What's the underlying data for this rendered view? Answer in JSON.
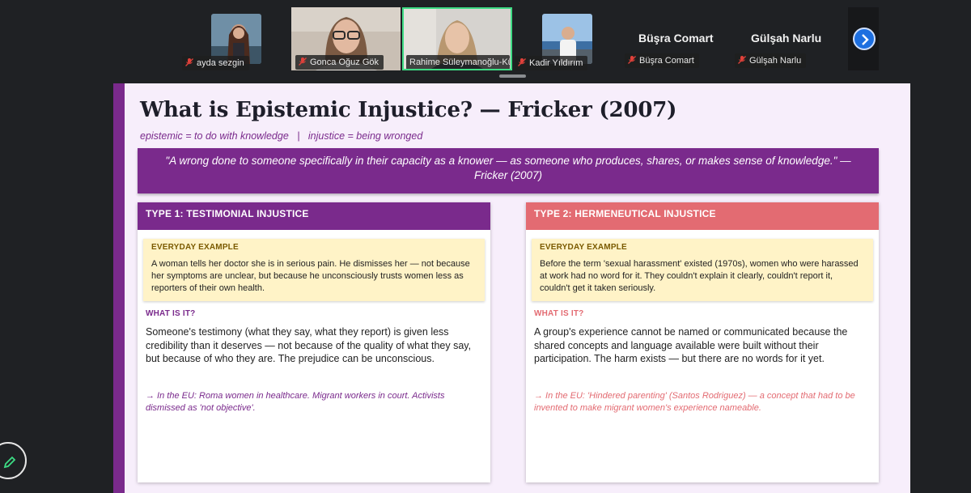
{
  "participants": [
    {
      "name": "ayda sezgin"
    },
    {
      "name": "Gonca Oğuz Gök"
    },
    {
      "name": "Rahime Süleymanoğlu-Kü..."
    },
    {
      "name": "Kadir Yıldırım"
    },
    {
      "name": "Büşra Comart",
      "display_name": "Büşra Comart"
    },
    {
      "name": "Gülşah Narlu",
      "display_name": "Gülşah Narlu"
    }
  ],
  "colors": {
    "slide_bg": "#f7eefb",
    "purple": "#7a2a8c",
    "coral": "#e36b72",
    "example_bg": "#fff3c7",
    "active_speaker": "#3ddc84",
    "next_button": "#1d6fe0"
  },
  "icons": {
    "muted": "mic-off-icon",
    "next": "chevron-right-icon",
    "annotate": "pencil-icon"
  },
  "slide": {
    "title": "What is Epistemic Injustice? — Fricker (2007)",
    "subtitle": "epistemic = to do with knowledge   |   injustice = being wronged",
    "quote": "\"A wrong done to someone specifically in their capacity as a knower — as someone who produces, shares, or makes sense of knowledge.\" — Fricker (2007)",
    "cards": [
      {
        "header": "TYPE 1: TESTIMONIAL INJUSTICE",
        "example_label": "EVERYDAY EXAMPLE",
        "example_text": "A woman tells her doctor she is in serious pain. He dismisses her — not because her symptoms are unclear, but because he unconsciously trusts women less as reporters of their own health.",
        "what_label": "WHAT IS IT?",
        "what_text": "Someone's testimony (what they say, what they report) is given less credibility than it deserves — not because of the quality of what they say, but because of who they are. The prejudice can be unconscious.",
        "eu_text": "→ In the EU: Roma women in healthcare. Migrant workers in court. Activists dismissed as 'not objective'."
      },
      {
        "header": "TYPE 2: HERMENEUTICAL INJUSTICE",
        "example_label": "EVERYDAY EXAMPLE",
        "example_text": "Before the term 'sexual harassment' existed (1970s), women who were harassed at work had no word for it. They couldn't explain it clearly, couldn't report it, couldn't get it taken seriously.",
        "what_label": "WHAT IS IT?",
        "what_text": "A group's experience cannot be named or communicated because the shared concepts and language available were built without their participation. The harm exists — but there are no words for it yet.",
        "eu_text": "→ In the EU: 'Hindered parenting' (Santos Rodriguez) — a concept that had to be invented to make migrant women's experience nameable."
      }
    ]
  }
}
